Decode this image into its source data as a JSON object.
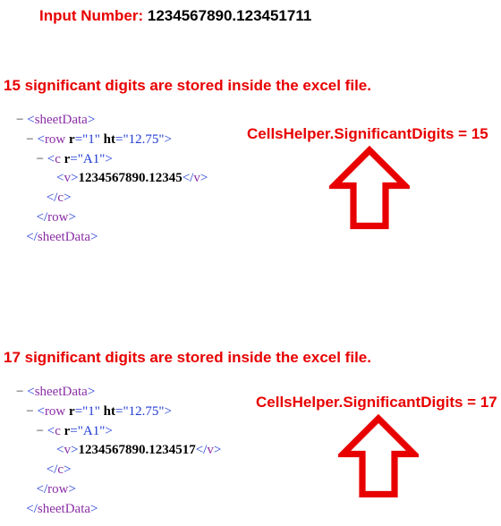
{
  "input": {
    "label": "Input Number: ",
    "value": "1234567890.123451711"
  },
  "code15": "CellsHelper.SignificantDigits = 15",
  "code17": "CellsHelper.SignificantDigits = 17",
  "title15": "15 significant digits are stored inside the excel file.",
  "title17": "17 significant digits are stored inside the excel file.",
  "xml15": {
    "row_r": "1",
    "row_ht": "12.75",
    "c_r": "A1",
    "v": "1234567890.12345"
  },
  "xml17": {
    "row_r": "1",
    "row_ht": "12.75",
    "c_r": "A1",
    "v": "1234567890.1234517"
  }
}
